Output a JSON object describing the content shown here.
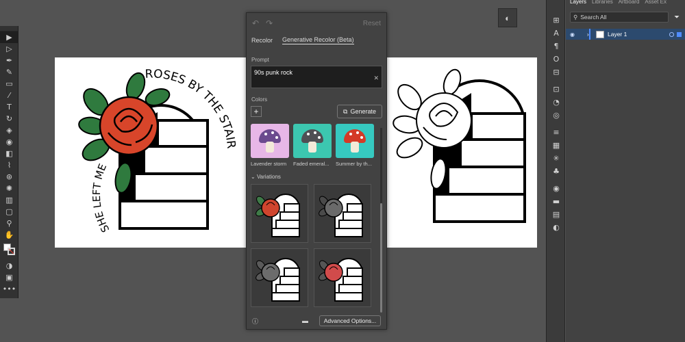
{
  "toolbar": {
    "tools": [
      {
        "name": "selection-tool",
        "glyph": "▶",
        "selected": true
      },
      {
        "name": "direct-selection-tool",
        "glyph": "▷"
      },
      {
        "name": "pen-tool",
        "glyph": "✒"
      },
      {
        "name": "curvature-tool",
        "glyph": "✎"
      },
      {
        "name": "rectangle-tool",
        "glyph": "▭"
      },
      {
        "name": "paintbrush-tool",
        "glyph": "⁄"
      },
      {
        "name": "type-tool",
        "glyph": "T"
      },
      {
        "name": "rotate-tool",
        "glyph": "↻"
      },
      {
        "name": "eraser-tool",
        "glyph": "◈"
      },
      {
        "name": "shape-builder-tool",
        "glyph": "◉"
      },
      {
        "name": "gradient-tool",
        "glyph": "◧"
      },
      {
        "name": "eyedropper-tool",
        "glyph": "⌇"
      },
      {
        "name": "blend-tool",
        "glyph": "⊛"
      },
      {
        "name": "symbol-sprayer-tool",
        "glyph": "✺"
      },
      {
        "name": "column-graph-tool",
        "glyph": "▥"
      },
      {
        "name": "artboard-tool",
        "glyph": "▢"
      },
      {
        "name": "zoom-tool",
        "glyph": "⚲"
      },
      {
        "name": "hand-tool",
        "glyph": "✋"
      }
    ],
    "bottom": [
      {
        "name": "draw-mode-icon",
        "glyph": "◑"
      },
      {
        "name": "screen-mode-icon",
        "glyph": "▣"
      },
      {
        "name": "more-tools-icon",
        "glyph": "•••"
      }
    ]
  },
  "recolor": {
    "reset_label": "Reset",
    "tab_recolor": "Recolor",
    "tab_generative": "Generative Recolor (Beta)",
    "prompt_label": "Prompt",
    "prompt_value": "90s punk rock",
    "colors_label": "Colors",
    "generate_label": "Generate",
    "samples": [
      {
        "caption": "Lavender storm",
        "bg": "#e7b7e7",
        "cap": "#6b4a8e",
        "dots": "#ffffff"
      },
      {
        "caption": "Faded emeral...",
        "bg": "#3cc7b0",
        "cap": "#4f4f54",
        "dots": "#ffffff"
      },
      {
        "caption": "Summer by th...",
        "bg": "#36c9c0",
        "cap": "#d43a27",
        "dots": "#ffffff"
      }
    ],
    "variations_label": "Variations",
    "variations": [
      {
        "rose": "#d0452e",
        "leaf": "#3f7a48"
      },
      {
        "rose": "#6a6a6a",
        "leaf": "#4a4a4a"
      },
      {
        "rose": "#6c6c6c",
        "leaf": "#5a5a5a"
      },
      {
        "rose": "#d14b4b",
        "leaf": "#555555"
      }
    ],
    "advanced_label": "Advanced Options..."
  },
  "artwork": {
    "line1": "ROSES BY THE STAIRS",
    "line2": "SHE LEFT ME",
    "rose_color": "#d8452a",
    "leaf_color": "#2f7a3e",
    "ink": "#000000"
  },
  "strip_icons": [
    "transform-icon",
    "character-icon",
    "paragraph-icon",
    "opentype-icon",
    "align-icon",
    "pathfinder-icon",
    "transparency-icon",
    "appearance-icon",
    "graphic-styles-icon",
    "swatches-icon",
    "brushes-icon",
    "symbols-icon",
    "color-guide-icon",
    "stroke-icon",
    "gradient-icon",
    "layers-icon"
  ],
  "strip_glyphs": [
    "⊞",
    "A",
    "¶",
    "O",
    "⊟",
    "⊡",
    "◔",
    "◎",
    "≡",
    "▦",
    "✳",
    "♣",
    "◉",
    "▬",
    "▤",
    "◐"
  ],
  "layers": {
    "tabs": [
      "Layers",
      "Libraries",
      "Artboard",
      "Asset Ex"
    ],
    "search_placeholder": "Search All",
    "layer_name": "Layer 1"
  }
}
